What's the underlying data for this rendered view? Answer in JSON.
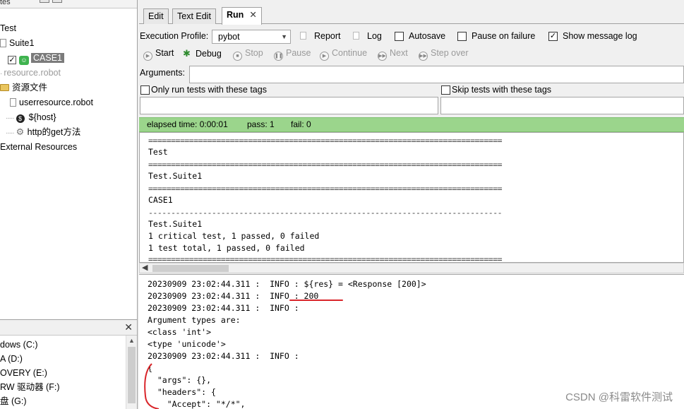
{
  "tree": {
    "header": "tes",
    "nodes": [
      {
        "label": "Test"
      },
      {
        "label": "Suite1"
      },
      {
        "label": "CASE1"
      },
      {
        "label": "resource.robot"
      },
      {
        "label": "资源文件"
      },
      {
        "label": "userresource.robot"
      },
      {
        "label": "${host}"
      },
      {
        "label": "http的get方法"
      },
      {
        "label": "External Resources"
      }
    ]
  },
  "drives": {
    "close_glyph": "✕",
    "items": [
      {
        "label": "dows (C:)"
      },
      {
        "label": "A (D:)"
      },
      {
        "label": "OVERY (E:)"
      },
      {
        "label": "RW 驱动器 (F:)"
      },
      {
        "label": "盘 (G:)"
      }
    ]
  },
  "tabs": [
    {
      "label": "Edit"
    },
    {
      "label": "Text Edit"
    },
    {
      "label": "Run",
      "close": "✕"
    }
  ],
  "run": {
    "profile_label": "Execution Profile:",
    "profile_value": "pybot",
    "report_label": "Report",
    "log_label": "Log",
    "autosave_label": "Autosave",
    "pause_failure_label": "Pause on failure",
    "show_message_log_label": "Show message log",
    "show_message_log_checked": "✓",
    "buttons": {
      "start": "Start",
      "debug": "Debug",
      "stop": "Stop",
      "pause": "Pause",
      "continue": "Continue",
      "next": "Next",
      "step_over": "Step over"
    },
    "arguments_label": "Arguments:",
    "only_run_label": "Only run tests with these tags",
    "skip_label": "Skip tests with these tags"
  },
  "status": {
    "elapsed": "elapsed time: 0:00:01",
    "pass": "pass: 1",
    "fail": "fail: 0"
  },
  "output_summary": [
    "==============================================================================",
    "Test",
    "==============================================================================",
    "Test.Suite1",
    "==============================================================================",
    "CASE1",
    "------------------------------------------------------------------------------",
    "Test.Suite1",
    "1 critical test, 1 passed, 0 failed",
    "1 test total, 1 passed, 0 failed",
    "=============================================================================="
  ],
  "message_log": [
    "20230909 23:02:44.311 :  INFO : ${res} = <Response [200]>",
    "20230909 23:02:44.311 :  INFO : 200",
    "20230909 23:02:44.311 :  INFO :",
    "Argument types are:",
    "<class 'int'>",
    "<type 'unicode'>",
    "20230909 23:02:44.311 :  INFO :",
    "{",
    "  \"args\": {},",
    "  \"headers\": {",
    "    \"Accept\": \"*/*\","
  ],
  "watermark": "CSDN @科雷软件测试",
  "colors": {
    "status_bar": "#9bd58c",
    "annotation": "#d9252a"
  }
}
